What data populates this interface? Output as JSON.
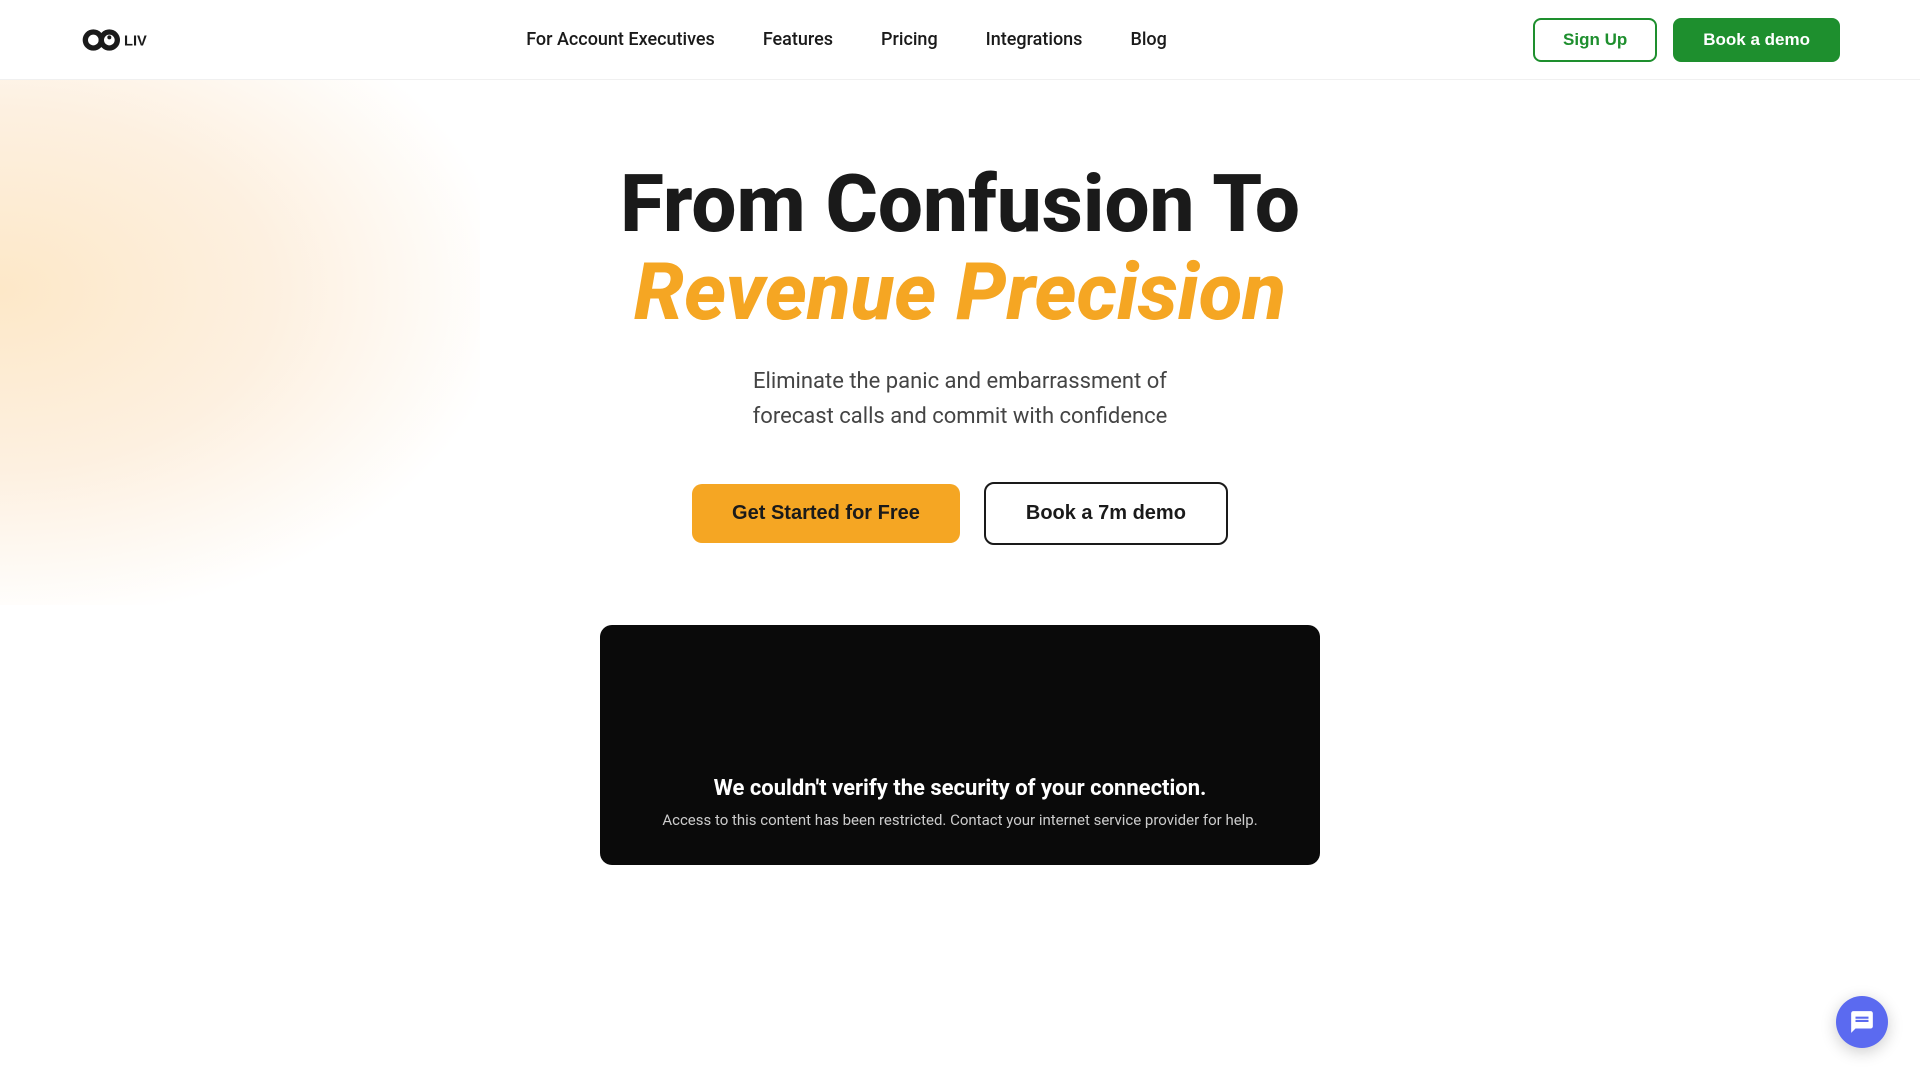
{
  "navbar": {
    "logo_alt": "Oliv logo",
    "links": [
      {
        "id": "for-account-executives",
        "label": "For Account Executives"
      },
      {
        "id": "features",
        "label": "Features"
      },
      {
        "id": "pricing",
        "label": "Pricing"
      },
      {
        "id": "integrations",
        "label": "Integrations"
      },
      {
        "id": "blog",
        "label": "Blog"
      }
    ],
    "signup_label": "Sign Up",
    "demo_label": "Book a demo"
  },
  "hero": {
    "title_line1": "From Confusion To",
    "title_line2": "Revenue Precision",
    "subtitle_line1": "Eliminate the panic and embarrassment of",
    "subtitle_line2": "forecast calls and commit with confidence",
    "btn_get_started": "Get Started for Free",
    "btn_book_demo": "Book a 7m demo"
  },
  "video": {
    "error_title": "We couldn't verify the security of your connection.",
    "error_subtitle": "Access to this content has been restricted. Contact your internet service provider for help."
  },
  "colors": {
    "accent_orange": "#f5a623",
    "accent_green": "#1e8f2e",
    "dark": "#1a1a1a",
    "chat_bg": "#5b6af0"
  }
}
